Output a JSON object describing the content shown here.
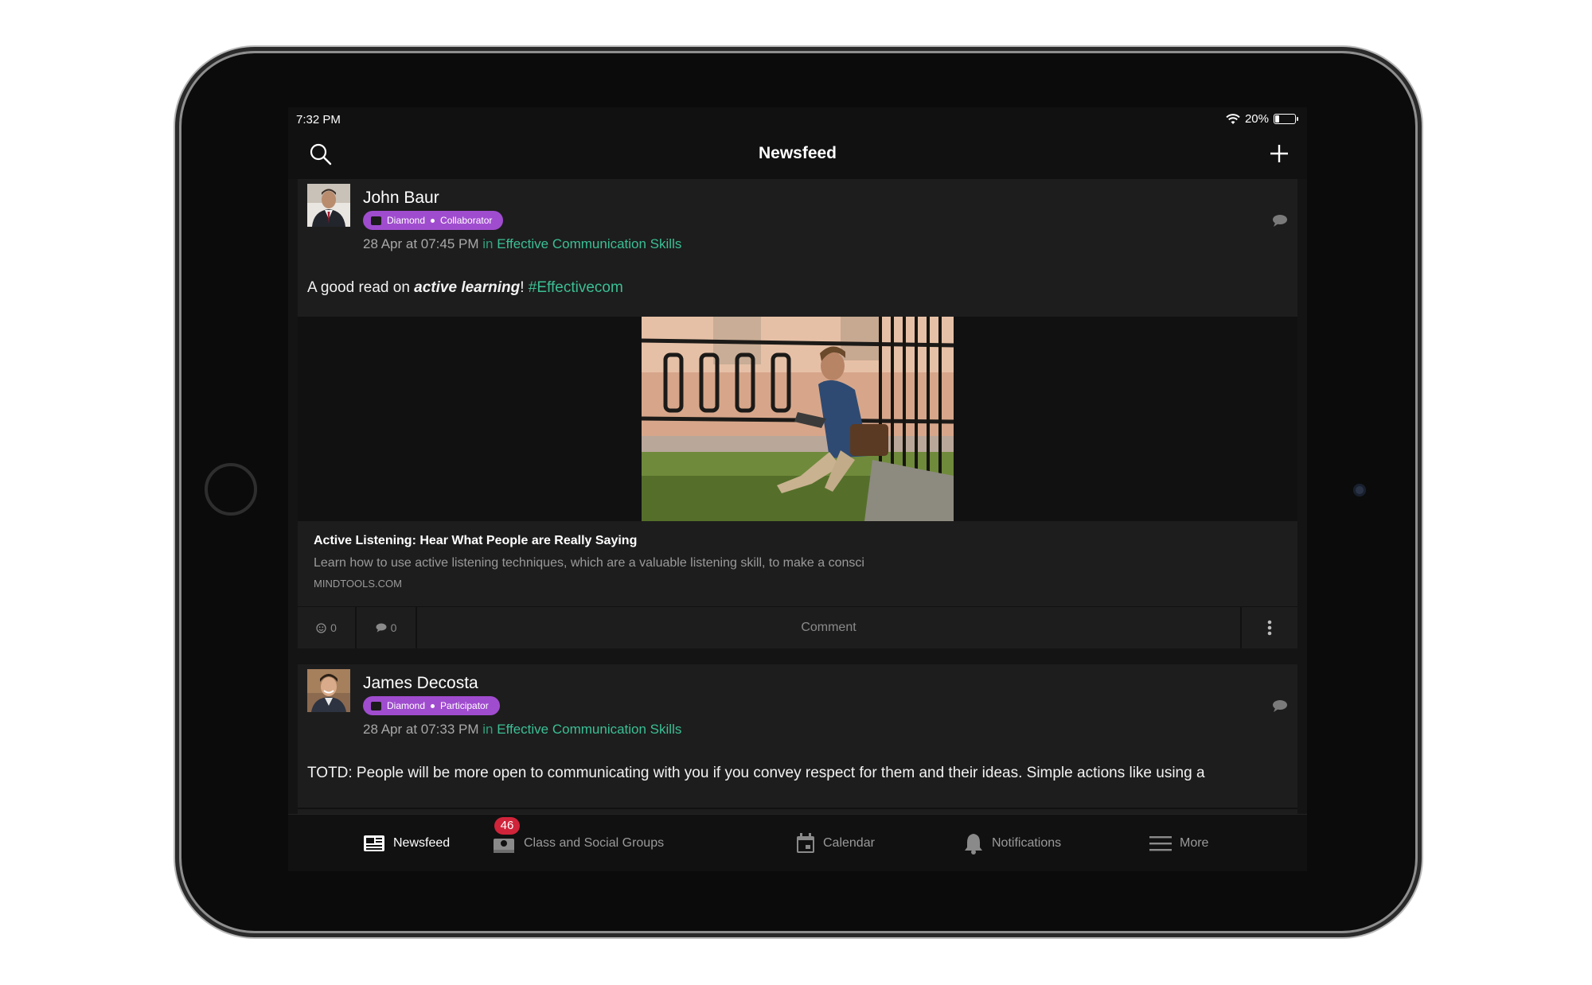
{
  "status_bar": {
    "time": "7:32 PM",
    "battery": "20%",
    "battery_level": 0.2
  },
  "header": {
    "title": "Newsfeed",
    "search_icon": "search-icon",
    "add_icon": "plus-icon"
  },
  "posts": [
    {
      "author": "John Baur",
      "badge": {
        "tier": "Diamond",
        "role": "Collaborator"
      },
      "timestamp": "28 Apr at 07:45 PM",
      "in_label": "in",
      "group": "Effective Communication Skills",
      "body_prefix": "A good read on ",
      "body_emphasis": "active learning",
      "body_suffix": "!",
      "hashtag": "#Effectivecom",
      "link": {
        "title": "Active Listening: Hear What People are Really Saying",
        "description": "Learn how to use active listening techniques, which are a valuable listening skill, to make a consci",
        "domain": "MINDTOOLS.COM"
      },
      "reactions": "0",
      "comments": "0",
      "comment_label": "Comment"
    },
    {
      "author": "James Decosta",
      "badge": {
        "tier": "Diamond",
        "role": "Participator"
      },
      "timestamp": "28 Apr at 07:33 PM",
      "in_label": "in",
      "group": "Effective Communication Skills",
      "body": "TOTD: People will be more open to communicating with you if you convey respect for them and their ideas. Simple actions like using a"
    }
  ],
  "tabs": [
    {
      "label": "Newsfeed",
      "icon": "newspaper-icon",
      "active": true
    },
    {
      "label": "Class and Social Groups",
      "icon": "groups-icon",
      "badge": "46"
    },
    {
      "label": "Calendar",
      "icon": "calendar-icon"
    },
    {
      "label": "Notifications",
      "icon": "bell-icon"
    },
    {
      "label": "More",
      "icon": "menu-icon"
    }
  ],
  "colors": {
    "accent": "#3bbf95",
    "badge": "#a04ccf",
    "notification_badge": "#d0243a",
    "background": "#141414"
  }
}
